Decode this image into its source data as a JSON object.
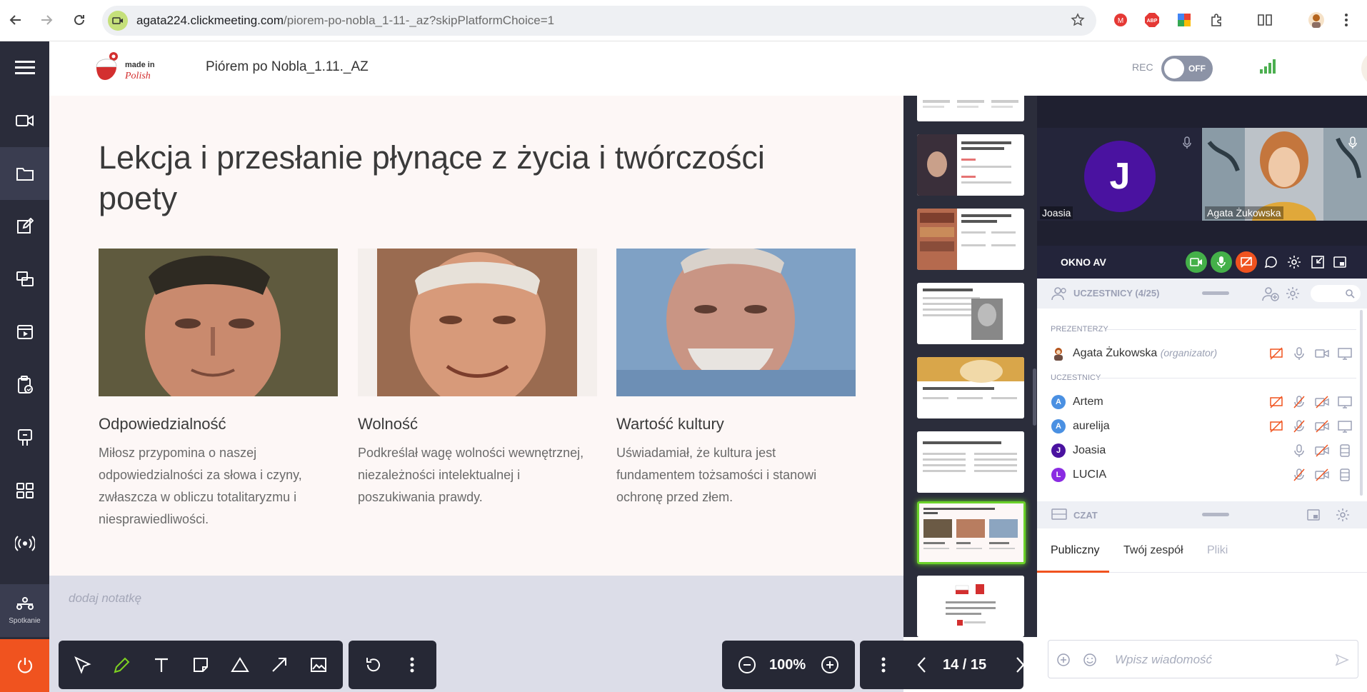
{
  "browser": {
    "url_host": "agata224.clickmeeting.com",
    "url_path": "/piorem-po-nobla_1-11-_az?skipPlatformChoice=1"
  },
  "header": {
    "meeting_title": "Piórem po Nobla_1.11._AZ",
    "rec_label": "REC",
    "rec_state": "OFF",
    "logo_text": "made in Polish"
  },
  "sidebar": {
    "items": [
      "menu",
      "video",
      "files",
      "editor",
      "screen-share",
      "media",
      "tests",
      "whiteboard",
      "layouts",
      "broadcast"
    ],
    "active_label": "Spotkanie"
  },
  "slide": {
    "title": "Lekcja i przesłanie płynące z życia i twórczości poety",
    "columns": [
      {
        "title": "Odpowiedzialność",
        "text": "Miłosz przypomina o naszej odpowiedzialności za słowa i czyny, zwłaszcza w obliczu totalitaryzmu i niesprawiedliwości."
      },
      {
        "title": "Wolność",
        "text": "Podkreślał wagę wolności wewnętrznej, niezależności intelektualnej i poszukiwania prawdy."
      },
      {
        "title": "Wartość kultury",
        "text": "Uświadamiał, że kultura jest fundamentem tożsamości i stanowi ochronę przed złem."
      }
    ]
  },
  "notes": {
    "placeholder": "dodaj notatkę"
  },
  "toolbar": {
    "zoom": "100%",
    "page": "14 / 15"
  },
  "video": {
    "tile1_initial": "J",
    "tile1_name": "Joasia",
    "tile2_name": "Agata Żukowska",
    "av_label": "OKNO AV"
  },
  "participants": {
    "header": "UCZESTNICY (4/25)",
    "presenters_label": "PREZENTERZY",
    "attendees_label": "UCZESTNICY",
    "presenter": {
      "name": "Agata Żukowska",
      "role": "(organizator)"
    },
    "list": [
      {
        "initial": "A",
        "name": "Artem",
        "color": "#4a90e2"
      },
      {
        "initial": "A",
        "name": "aurelija",
        "color": "#4a90e2"
      },
      {
        "initial": "J",
        "name": "Joasia",
        "color": "#4a12a0"
      },
      {
        "initial": "L",
        "name": "LUCIA",
        "color": "#8a2be2"
      }
    ]
  },
  "chat": {
    "header": "CZAT",
    "tabs": [
      "Publiczny",
      "Twój zespół",
      "Pliki"
    ],
    "placeholder": "Wpisz wiadomość"
  },
  "colors": {
    "accent": "#f0531f",
    "sidebar": "#2a2c3a",
    "active_thumb": "#6bd12a"
  }
}
